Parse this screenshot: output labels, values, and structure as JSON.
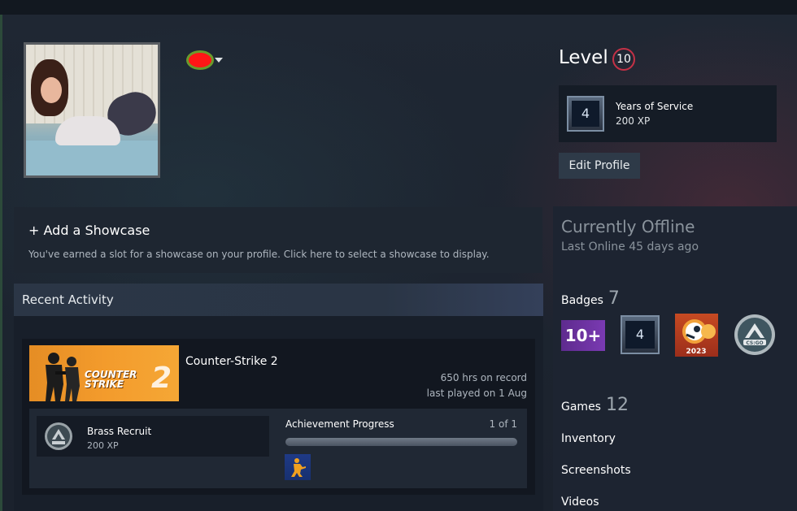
{
  "profile": {
    "level_label": "Level",
    "level_value": "10",
    "service_badge_number": "4",
    "service_title": "Years of Service",
    "service_xp": "200 XP",
    "edit_label": "Edit Profile"
  },
  "showcase": {
    "title": "+ Add a Showcase",
    "description": "You've earned a slot for a showcase on your profile. Click here to select a showcase to display."
  },
  "recent": {
    "title": "Recent Activity",
    "game": {
      "name": "Counter-Strike 2",
      "banner_line1": "COUNTER",
      "banner_line2": "STRIKE",
      "banner_number": "2",
      "hours": "650 hrs on record",
      "last_played": "last played on 1 Aug",
      "achievement_name": "Brass Recruit",
      "achievement_xp": "200 XP",
      "progress_label": "Achievement Progress",
      "progress_count": "1 of 1",
      "progress_fraction": 1.0
    }
  },
  "sidebar": {
    "status": "Currently Offline",
    "last_online": "Last Online 45 days ago",
    "badges_label": "Badges",
    "badges_count": "7",
    "badge_1_text": "10+",
    "badge_2_text": "4",
    "badge_3_text": "2023",
    "badge_4_text": "CS:GO",
    "games_label": "Games",
    "games_count": "12",
    "inventory": "Inventory",
    "screenshots": "Screenshots",
    "videos": "Videos"
  },
  "colors": {
    "level_ring": "#c43146",
    "background": "#1c2330",
    "panel": "#1d2431"
  }
}
